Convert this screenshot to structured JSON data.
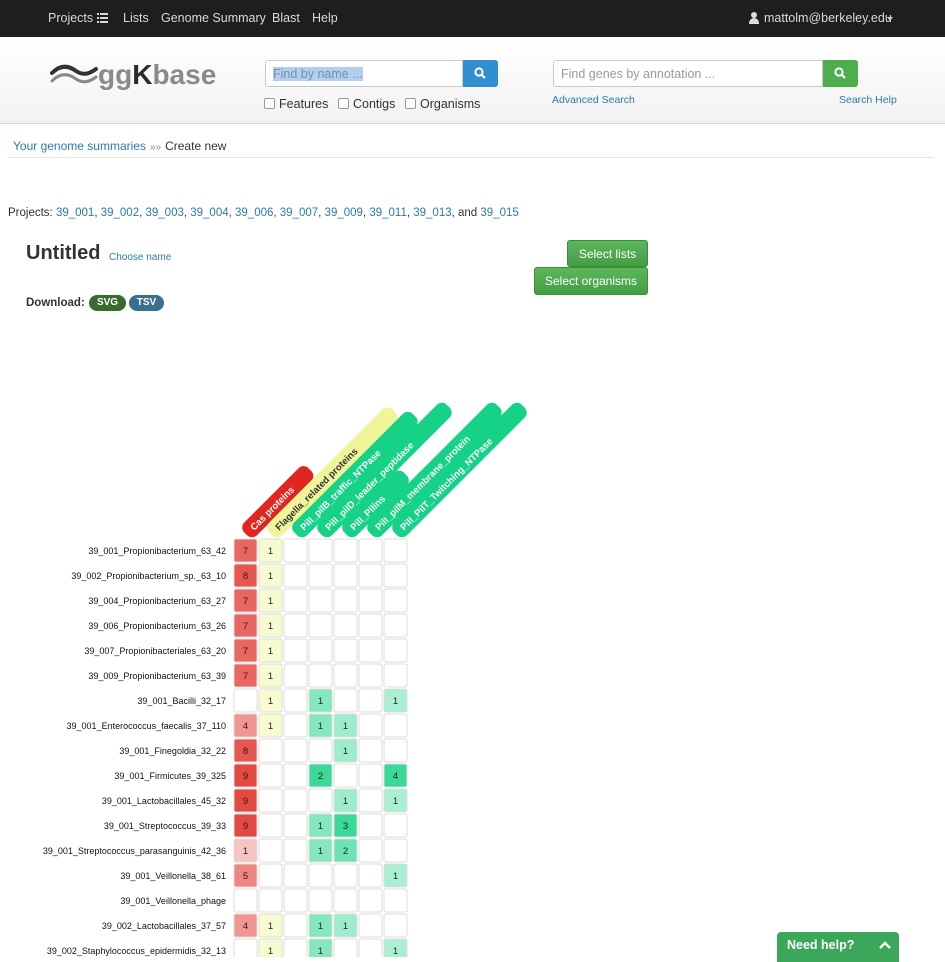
{
  "nav": {
    "projects": "Projects",
    "lists": "Lists",
    "genome_summary": "Genome Summary",
    "blast": "Blast",
    "help": "Help",
    "user": "mattolm@berkeley.edu"
  },
  "header": {
    "logo_prefix": "gg",
    "logo_k": "K",
    "logo_suffix": "base",
    "name_search_placeholder": "Find by name ...",
    "annotation_search_placeholder": "Find genes by annotation ...",
    "filters": [
      "Features",
      "Contigs",
      "Organisms"
    ],
    "advanced_search": "Advanced Search",
    "search_help": "Search Help"
  },
  "breadcrumb": {
    "parent": "Your genome summaries",
    "separator": "»»",
    "current": "Create new"
  },
  "projects": {
    "label": "Projects:",
    "items": [
      "39_001",
      "39_002",
      "39_003",
      "39_004",
      "39_006",
      "39_007",
      "39_009",
      "39_011",
      "39_013",
      "39_015"
    ],
    "last_joiner": "and"
  },
  "summary": {
    "title": "Untitled",
    "choose_name": "Choose name",
    "select_lists": "Select lists",
    "select_organisms": "Select organisms",
    "download_label": "Download:",
    "svg_label": "SVG",
    "tsv_label": "TSV"
  },
  "colors": {
    "red": "#e0261f",
    "yellow": "#f0f59a",
    "green": "#16d286",
    "link": "#2a7ab0",
    "button_green": "#4cae4c"
  },
  "chart_data": {
    "type": "heatmap",
    "columns": [
      {
        "label": "Cas proteins",
        "color": "#e0261f"
      },
      {
        "label": "Flagella_related proteins",
        "color": "#f0f59a"
      },
      {
        "label": "PilI_pilB_traffic_NTPase",
        "color": "#16d286"
      },
      {
        "label": "PilI_pilD_leader_peptidase",
        "color": "#16d286"
      },
      {
        "label": "PilI_Pilins",
        "color": "#16d286"
      },
      {
        "label": "PilI_pilM_membrane_protein",
        "color": "#16d286"
      },
      {
        "label": "PilI_PilT_Twitching_NTPase",
        "color": "#16d286"
      }
    ],
    "rows": [
      "39_001_Propionibacterium_63_42",
      "39_002_Propionibacterium_sp._63_10",
      "39_004_Propionibacterium_63_27",
      "39_006_Propionibacterium_63_26",
      "39_007_Propionibacteriales_63_20",
      "39_009_Propionibacterium_63_39",
      "39_001_Bacilli_32_17",
      "39_001_Enterococcus_faecalis_37_110",
      "39_001_Finegoldia_32_22",
      "39_001_Firmicutes_39_325",
      "39_001_Lactobacillales_45_32",
      "39_001_Streptococcus_39_33",
      "39_001_Streptococcus_parasanguinis_42_36",
      "39_001_Veillonella_38_61",
      "39_001_Veillonella_phage",
      "39_002_Lactobacillales_37_57",
      "39_002_Staphylococcus_epidermidis_32_13"
    ],
    "values": [
      [
        7,
        1,
        0,
        0,
        0,
        0,
        0
      ],
      [
        8,
        1,
        0,
        0,
        0,
        0,
        0
      ],
      [
        7,
        1,
        0,
        0,
        0,
        0,
        0
      ],
      [
        7,
        1,
        0,
        0,
        0,
        0,
        0
      ],
      [
        7,
        1,
        0,
        0,
        0,
        0,
        0
      ],
      [
        7,
        1,
        0,
        0,
        0,
        0,
        0
      ],
      [
        0,
        1,
        0,
        1,
        0,
        0,
        1
      ],
      [
        4,
        1,
        0,
        1,
        1,
        0,
        0
      ],
      [
        8,
        0,
        0,
        0,
        1,
        0,
        0
      ],
      [
        9,
        0,
        0,
        2,
        0,
        0,
        4
      ],
      [
        9,
        0,
        0,
        0,
        1,
        0,
        1
      ],
      [
        9,
        0,
        0,
        1,
        3,
        0,
        0
      ],
      [
        1,
        0,
        0,
        1,
        2,
        0,
        0
      ],
      [
        5,
        0,
        0,
        0,
        0,
        0,
        1
      ],
      [
        0,
        0,
        0,
        0,
        0,
        0,
        0
      ],
      [
        4,
        1,
        0,
        1,
        1,
        0,
        0
      ],
      [
        0,
        1,
        0,
        1,
        0,
        0,
        1
      ]
    ]
  },
  "help_widget": {
    "label": "Need help?"
  }
}
